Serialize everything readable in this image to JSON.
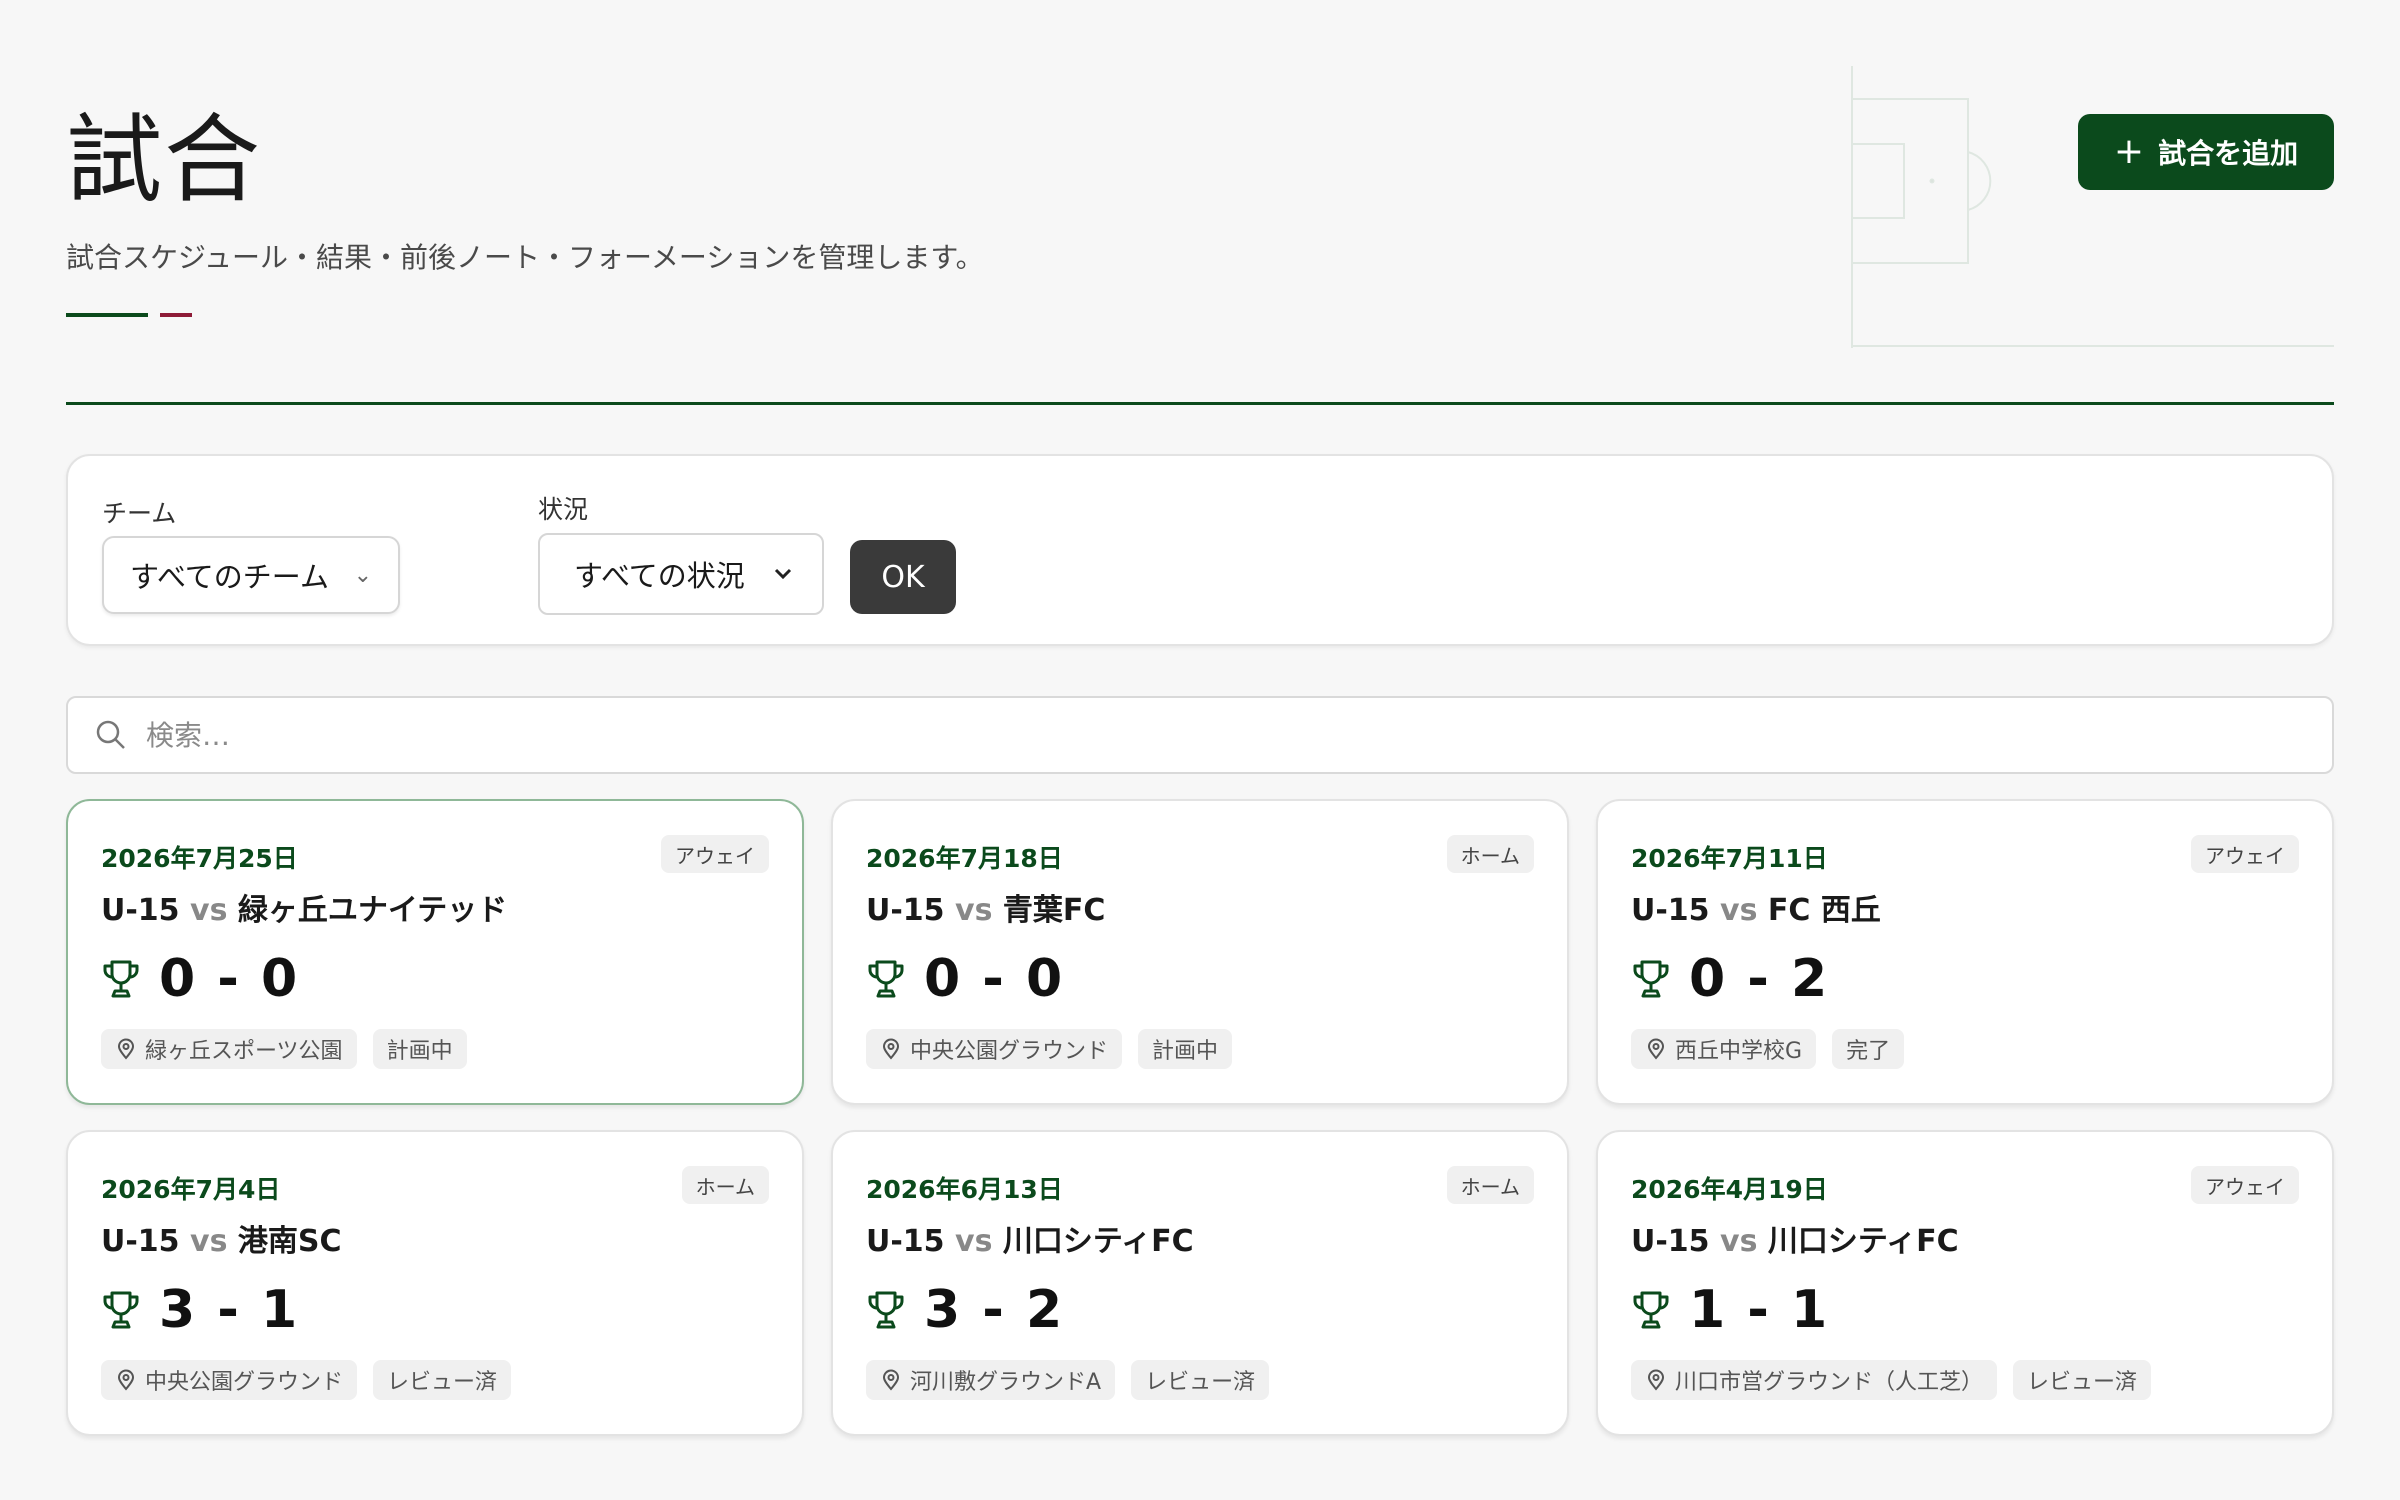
{
  "header": {
    "title": "試合",
    "subtitle": "試合スケジュール・結果・前後ノート・フォーメーションを管理します。",
    "add_button": "試合を追加"
  },
  "filters": {
    "team_label": "チーム",
    "team_value": "すべてのチーム",
    "status_label": "状況",
    "status_value": "すべての状況",
    "ok_button": "OK"
  },
  "search": {
    "placeholder": "検索…"
  },
  "colors": {
    "primary": "#0b4a1c",
    "accent_red": "#8e1b37",
    "dark_button": "#3a3a3a"
  },
  "matches": [
    {
      "date": "2026年7月25日",
      "venue_type": "アウェイ",
      "team": "U-15",
      "vs": "vs",
      "opponent": "緑ヶ丘ユナイテッド",
      "score": "0 - 0",
      "location": "緑ヶ丘スポーツ公園",
      "status": "計画中"
    },
    {
      "date": "2026年7月18日",
      "venue_type": "ホーム",
      "team": "U-15",
      "vs": "vs",
      "opponent": "青葉FC",
      "score": "0 - 0",
      "location": "中央公園グラウンド",
      "status": "計画中"
    },
    {
      "date": "2026年7月11日",
      "venue_type": "アウェイ",
      "team": "U-15",
      "vs": "vs",
      "opponent": "FC 西丘",
      "score": "0 - 2",
      "location": "西丘中学校G",
      "status": "完了"
    },
    {
      "date": "2026年7月4日",
      "venue_type": "ホーム",
      "team": "U-15",
      "vs": "vs",
      "opponent": "港南SC",
      "score": "3 - 1",
      "location": "中央公園グラウンド",
      "status": "レビュー済"
    },
    {
      "date": "2026年6月13日",
      "venue_type": "ホーム",
      "team": "U-15",
      "vs": "vs",
      "opponent": "川口シティFC",
      "score": "3 - 2",
      "location": "河川敷グラウンドA",
      "status": "レビュー済"
    },
    {
      "date": "2026年4月19日",
      "venue_type": "アウェイ",
      "team": "U-15",
      "vs": "vs",
      "opponent": "川口シティFC",
      "score": "1 - 1",
      "location": "川口市営グラウンド（人工芝）",
      "status": "レビュー済"
    }
  ]
}
